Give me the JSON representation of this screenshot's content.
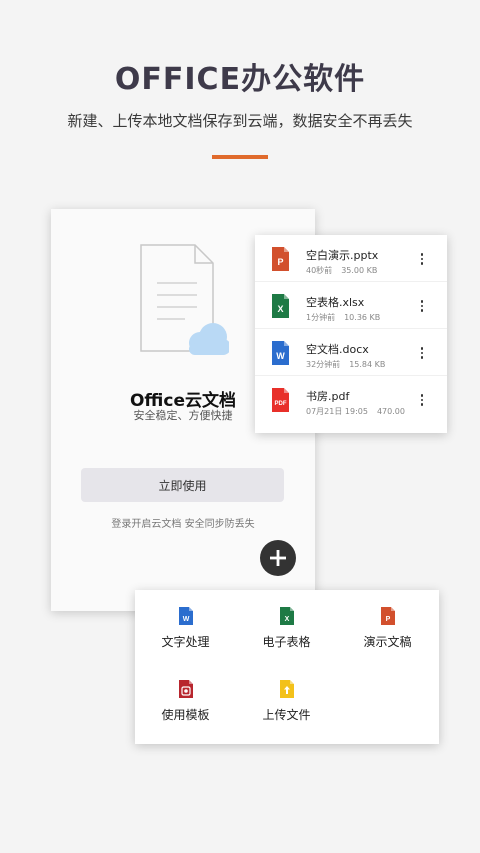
{
  "header": {
    "title": "OFFICE办公软件",
    "subtitle": "新建、上传本地文档保存到云端，数据安全不再丢失"
  },
  "phone": {
    "cloud_title": "Office云文档",
    "cloud_subtitle": "安全稳定、方便快捷",
    "use_button": "立即使用",
    "login_hint": "登录开启云文档  安全同步防丢失"
  },
  "files": [
    {
      "name": "空白演示.pptx",
      "time": "40秒前",
      "size": "35.00 KB",
      "type": "ppt",
      "icon": "ppt-file-icon"
    },
    {
      "name": "空表格.xlsx",
      "time": "1分钟前",
      "size": "10.36 KB",
      "type": "xls",
      "icon": "excel-file-icon"
    },
    {
      "name": "空文档.docx",
      "time": "32分钟前",
      "size": "15.84 KB",
      "type": "doc",
      "icon": "word-file-icon"
    },
    {
      "name": "书房.pdf",
      "time": "07月21日 19:05",
      "size": "470.00",
      "type": "pdf",
      "icon": "pdf-file-icon"
    }
  ],
  "create": [
    {
      "label": "文字处理",
      "type": "doc",
      "icon": "word-icon"
    },
    {
      "label": "电子表格",
      "type": "xls",
      "icon": "excel-icon"
    },
    {
      "label": "演示文稿",
      "type": "ppt",
      "icon": "ppt-icon"
    },
    {
      "label": "使用模板",
      "type": "tpl",
      "icon": "template-icon"
    },
    {
      "label": "上传文件",
      "type": "upl",
      "icon": "upload-icon"
    }
  ],
  "icon_letters": {
    "ppt": "P",
    "xls": "X",
    "doc": "W",
    "pdf": "PDF"
  },
  "colors": {
    "accent": "#e06a2c",
    "ppt": "#d2502d",
    "xls": "#1e7a45",
    "doc": "#2b6dce",
    "pdf": "#e8302a",
    "template": "#b8262e",
    "upload": "#f3c11a",
    "cloud": "#b9d9f5"
  }
}
